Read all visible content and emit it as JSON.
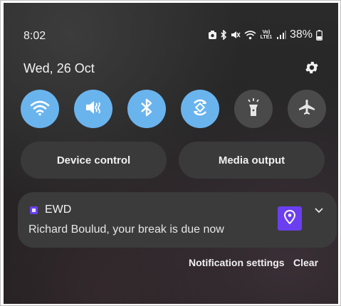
{
  "status_bar": {
    "time": "8:02",
    "network_label_top": "Vo)",
    "network_label_bottom": "LTE1",
    "battery_percent": "38%",
    "icons": [
      "alarm-icon",
      "bluetooth-icon",
      "mute-icon",
      "wifi-icon",
      "signal-icon",
      "battery-icon"
    ]
  },
  "header": {
    "date": "Wed, 26 Oct",
    "settings_icon": "gear-icon"
  },
  "quick_toggles": [
    {
      "name": "wifi",
      "icon": "wifi-icon",
      "state": "on"
    },
    {
      "name": "mute",
      "icon": "mute-icon",
      "state": "on"
    },
    {
      "name": "bluetooth",
      "icon": "bluetooth-icon",
      "state": "on"
    },
    {
      "name": "auto-rotate",
      "icon": "auto-rotate-icon",
      "state": "on"
    },
    {
      "name": "flashlight",
      "icon": "flashlight-icon",
      "state": "off"
    },
    {
      "name": "airplane-mode",
      "icon": "airplane-icon",
      "state": "off"
    }
  ],
  "controls": {
    "device_control_label": "Device control",
    "media_output_label": "Media output"
  },
  "notification": {
    "app_name": "EWD",
    "message": "Richard Boulud, your break is due now",
    "app_icon": "ewd-app-icon",
    "thumbnail_icon": "location-pin-icon"
  },
  "footer": {
    "notification_settings_label": "Notification settings",
    "clear_label": "Clear"
  },
  "colors": {
    "toggle_on": "#6ab4ee",
    "toggle_off": "#4a4a4a",
    "app_accent": "#6b3ff0",
    "panel_background": "#262626"
  }
}
